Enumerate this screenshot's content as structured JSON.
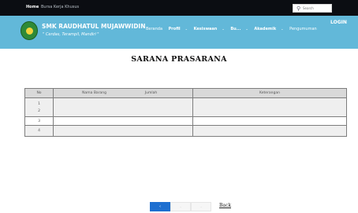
{
  "topbar": {
    "home": "Home",
    "bkk": "Bursa Kerja Khusus",
    "search_placeholder": "Search"
  },
  "header": {
    "school_name": "SMK RAUDHATUL MUJAWWIDIN",
    "tagline": "\" Cerdas, Terampil, Mandiri \"",
    "login": "LOGIN",
    "nav": [
      {
        "label": "Beranda"
      },
      {
        "label": "Profil"
      },
      {
        "label": "Kesiswaan"
      },
      {
        "label": "Bu..."
      },
      {
        "label": "Akademik"
      },
      {
        "label": "Pengumuman"
      }
    ]
  },
  "page_title": "SARANA PRASARANA",
  "table": {
    "headers": [
      "No",
      "Nama Barang",
      "Jumlah",
      "Keterangan"
    ],
    "rows": [
      {
        "no": [
          "1",
          "2"
        ]
      },
      {
        "no": [
          "3"
        ]
      },
      {
        "no": [
          "4"
        ]
      }
    ]
  },
  "pagination": {
    "pages": [
      "‹",
      "·",
      "·"
    ],
    "back": "Back"
  },
  "colors": {
    "topbar": "#0b0d12",
    "header": "#62b8d9",
    "accent": "#1e6fd0"
  }
}
